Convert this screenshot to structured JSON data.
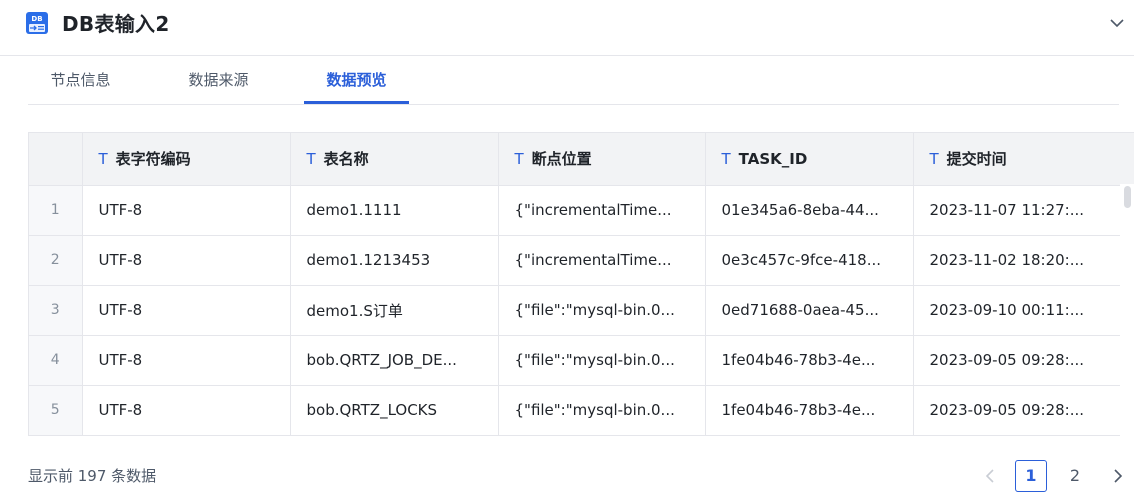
{
  "header": {
    "icon": "db-input-icon",
    "title": "DB表输入2",
    "collapse_icon": "chevron-down-icon"
  },
  "tabs": [
    {
      "label": "节点信息",
      "active": false
    },
    {
      "label": "数据来源",
      "active": false
    },
    {
      "label": "数据预览",
      "active": true
    }
  ],
  "table": {
    "column_type_icon": "T",
    "columns": [
      "表字符编码",
      "表名称",
      "断点位置",
      "TASK_ID",
      "提交时间"
    ],
    "rows": [
      {
        "index": "1",
        "cells": [
          "UTF-8",
          "demo1.1111",
          "{\"incrementalTime...",
          "01e345a6-8eba-44...",
          "2023-11-07 11:27:..."
        ]
      },
      {
        "index": "2",
        "cells": [
          "UTF-8",
          "demo1.1213453",
          "{\"incrementalTime...",
          "0e3c457c-9fce-418...",
          "2023-11-02 18:20:..."
        ]
      },
      {
        "index": "3",
        "cells": [
          "UTF-8",
          "demo1.S订单",
          "{\"file\":\"mysql-bin.0...",
          "0ed71688-0aea-45...",
          "2023-09-10 00:11:..."
        ]
      },
      {
        "index": "4",
        "cells": [
          "UTF-8",
          "bob.QRTZ_JOB_DE...",
          "{\"file\":\"mysql-bin.0...",
          "1fe04b46-78b3-4e...",
          "2023-09-05 09:28:..."
        ]
      },
      {
        "index": "5",
        "cells": [
          "UTF-8",
          "bob.QRTZ_LOCKS",
          "{\"file\":\"mysql-bin.0...",
          "1fe04b46-78b3-4e...",
          "2023-09-05 09:28:..."
        ]
      }
    ]
  },
  "footer": {
    "summary": "显示前 197 条数据"
  },
  "pagination": {
    "prev_icon": "chevron-left-icon",
    "pages": [
      "1",
      "2"
    ],
    "current": "1",
    "next_icon": "chevron-right-icon"
  },
  "colors": {
    "accent": "#2b5fd9",
    "border": "#e5e6eb",
    "header_bg": "#f2f3f5"
  }
}
